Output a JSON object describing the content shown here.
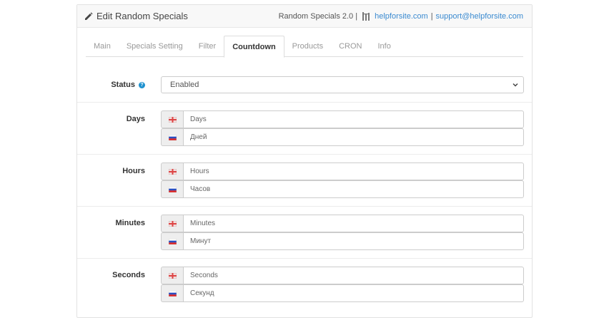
{
  "header": {
    "title": "Edit Random Specials",
    "version": "Random Specials 2.0 |",
    "site_link": "helpforsite.com",
    "separator": "|",
    "email_link": "support@helpforsite.com"
  },
  "tabs": [
    {
      "label": "Main"
    },
    {
      "label": "Specials Setting"
    },
    {
      "label": "Filter"
    },
    {
      "label": "Countdown",
      "active": true
    },
    {
      "label": "Products"
    },
    {
      "label": "CRON"
    },
    {
      "label": "Info"
    }
  ],
  "status": {
    "label": "Status",
    "value": "Enabled"
  },
  "fields": [
    {
      "label": "Days",
      "en": "Days",
      "ru": "Дней"
    },
    {
      "label": "Hours",
      "en": "Hours",
      "ru": "Часов"
    },
    {
      "label": "Minutes",
      "en": "Minutes",
      "ru": "Минут"
    },
    {
      "label": "Seconds",
      "en": "Seconds",
      "ru": "Секунд"
    }
  ],
  "icons": {
    "heading": "pencil-icon",
    "header_link": "sitemap-icon",
    "help": "question-icon",
    "select": "chevron-down-icon",
    "flag_en": "flag-en-icon",
    "flag_ru": "flag-ru-icon"
  },
  "colors": {
    "link": "#3a8ad0",
    "help_badge": "#1e91cf"
  }
}
